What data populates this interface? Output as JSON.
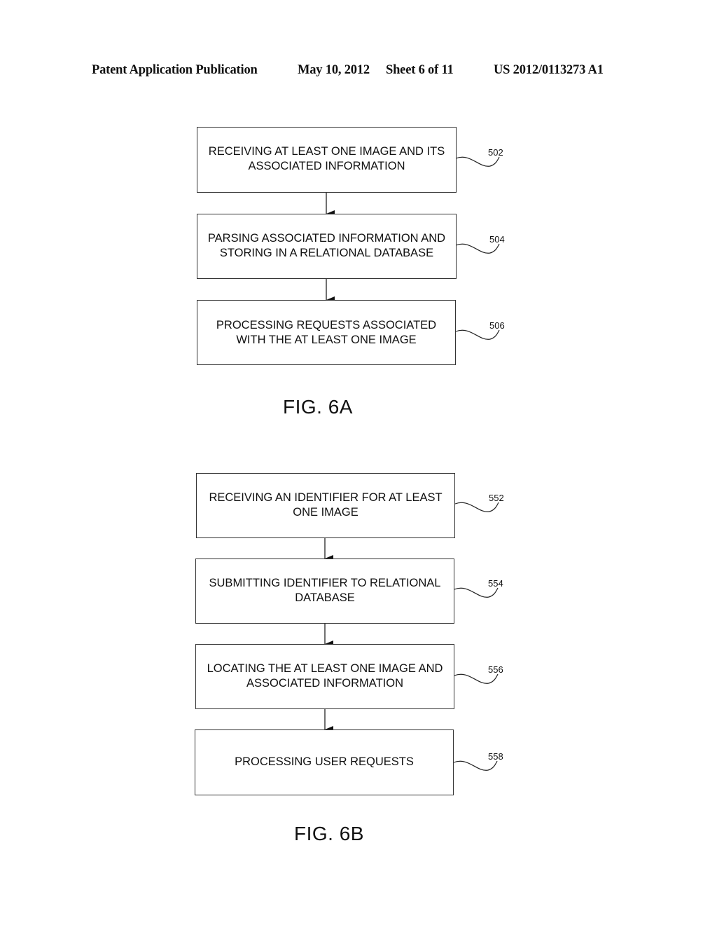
{
  "header": {
    "publication": "Patent Application Publication",
    "date": "May 10, 2012",
    "sheet": "Sheet 6 of 11",
    "number": "US 2012/0113273 A1"
  },
  "fig6a": {
    "caption": "FIG. 6A",
    "steps": [
      {
        "ref": "502",
        "text": "RECEIVING AT LEAST ONE IMAGE AND ITS\nASSOCIATED INFORMATION"
      },
      {
        "ref": "504",
        "text": "PARSING ASSOCIATED INFORMATION AND\nSTORING IN A RELATIONAL DATABASE"
      },
      {
        "ref": "506",
        "text": "PROCESSING REQUESTS ASSOCIATED\nWITH THE AT LEAST ONE IMAGE"
      }
    ]
  },
  "fig6b": {
    "caption": "FIG. 6B",
    "steps": [
      {
        "ref": "552",
        "text": "RECEIVING AN IDENTIFIER FOR AT LEAST\nONE IMAGE"
      },
      {
        "ref": "554",
        "text": "SUBMITTING IDENTIFIER TO RELATIONAL\nDATABASE"
      },
      {
        "ref": "556",
        "text": "LOCATING THE AT LEAST ONE IMAGE AND\nASSOCIATED INFORMATION"
      },
      {
        "ref": "558",
        "text": "PROCESSING USER REQUESTS"
      }
    ]
  }
}
